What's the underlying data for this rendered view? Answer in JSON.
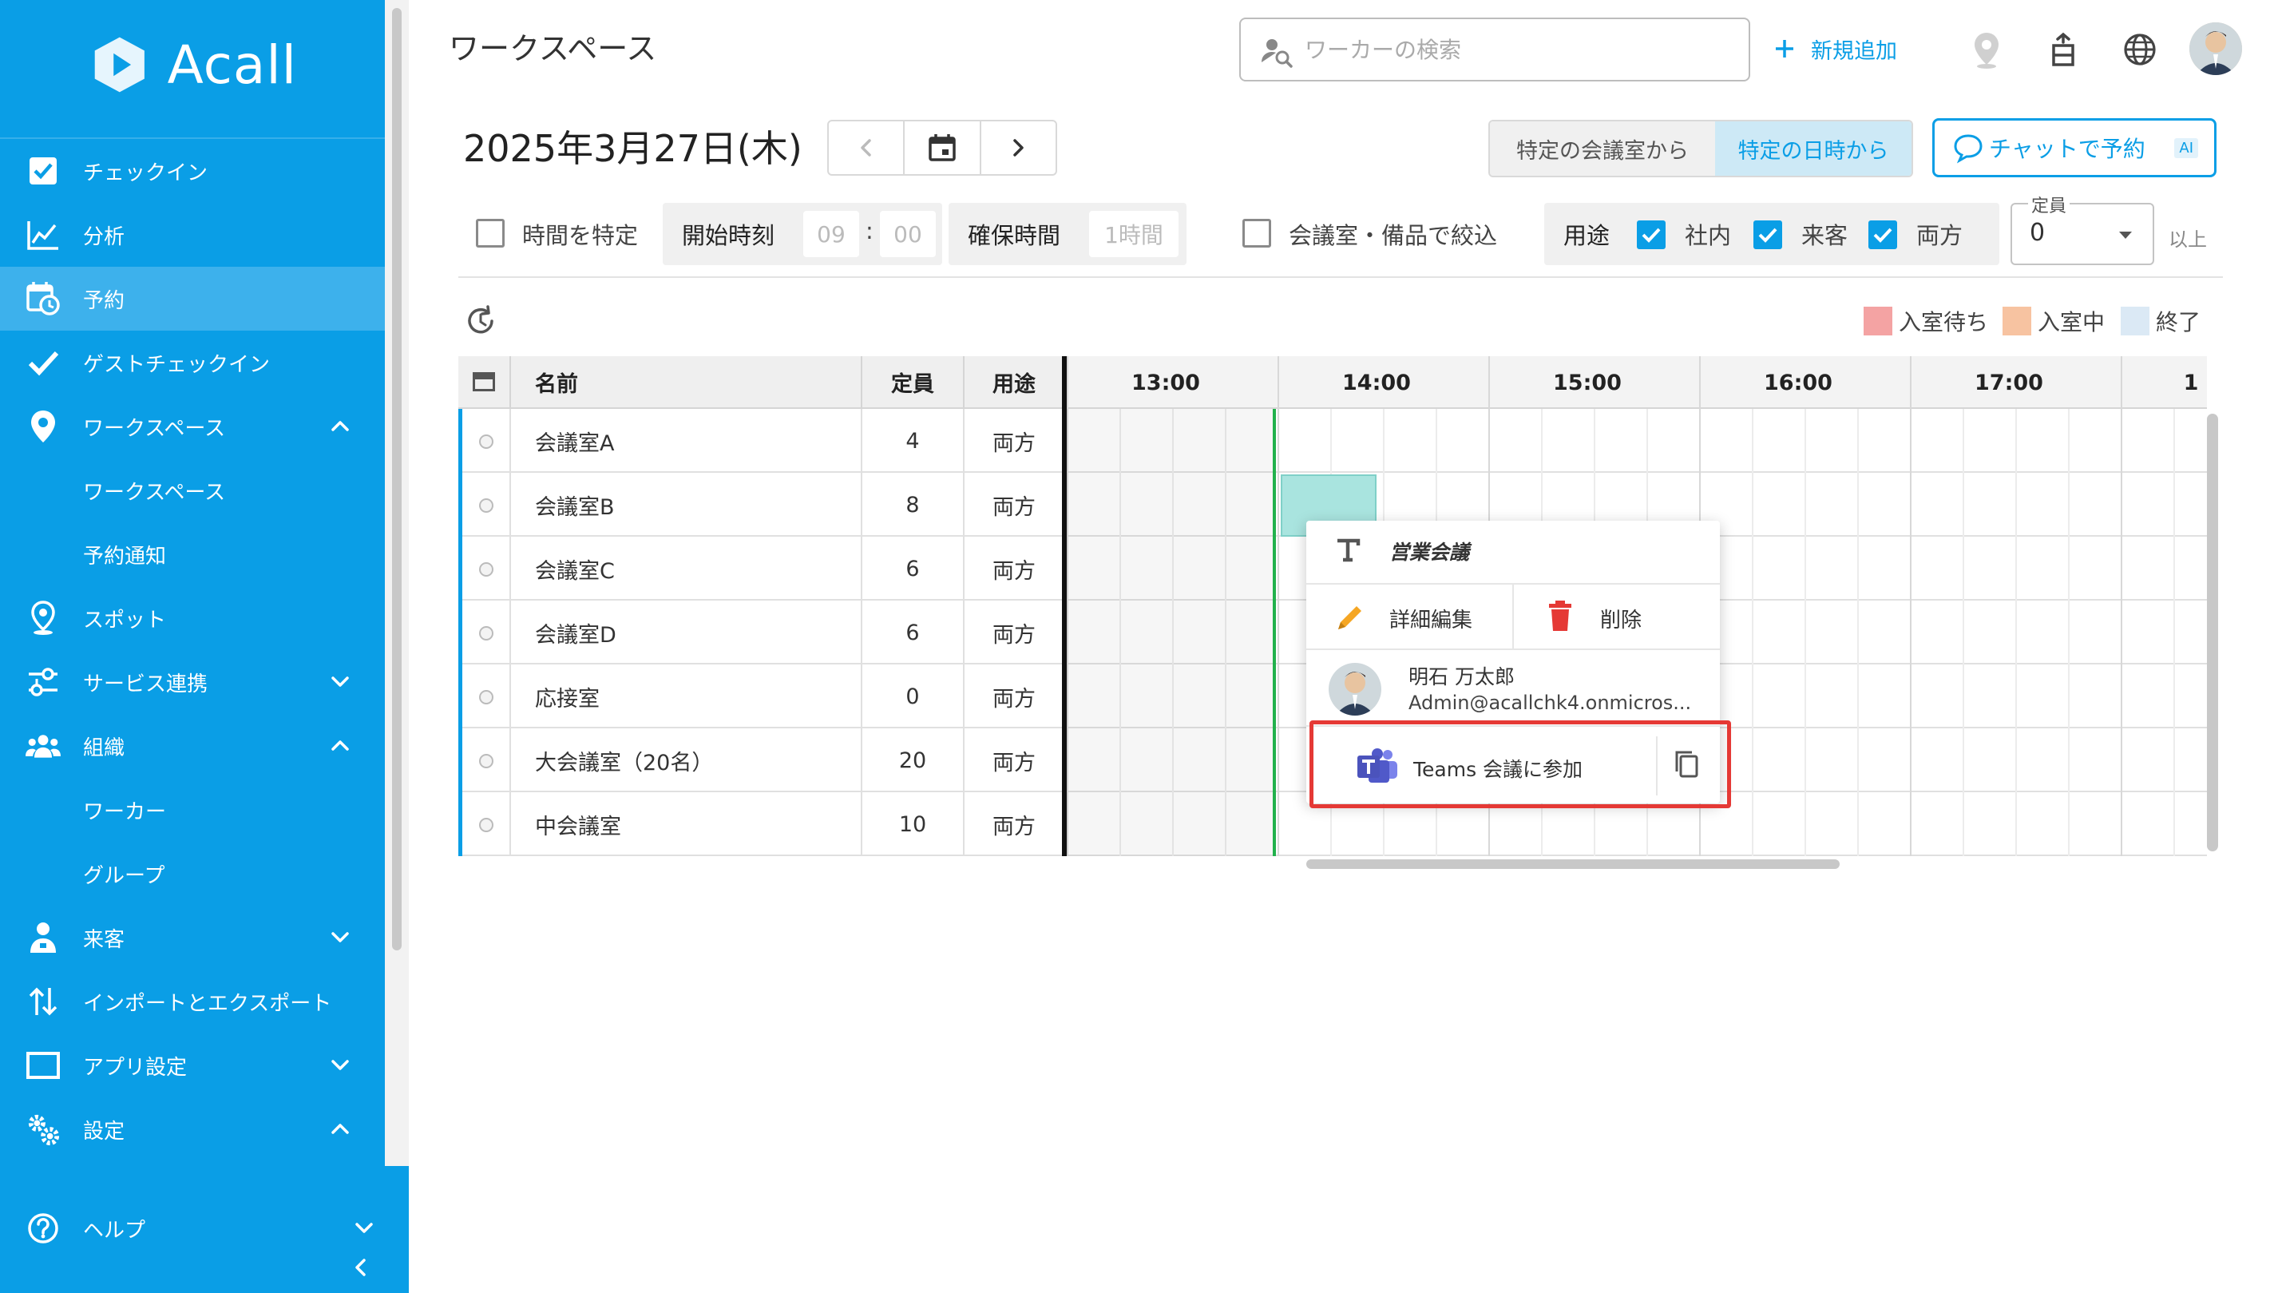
{
  "app": {
    "logo_text": "Acall"
  },
  "sidebar": {
    "items": [
      {
        "label": "チェックイン",
        "icon": "checkbox-icon"
      },
      {
        "label": "分析",
        "icon": "chart-icon"
      },
      {
        "label": "予約",
        "icon": "calendar-clock-icon",
        "active": true
      },
      {
        "label": "ゲストチェックイン",
        "icon": "checkmark-icon"
      },
      {
        "label": "ワークスペース",
        "icon": "location-pin-icon",
        "caret": "up"
      },
      {
        "label": "ワークスペース",
        "sub": true
      },
      {
        "label": "予約通知",
        "sub": true
      },
      {
        "label": "スポット",
        "icon": "spot-pin-icon"
      },
      {
        "label": "サービス連携",
        "icon": "integration-icon",
        "caret": "down"
      },
      {
        "label": "組織",
        "icon": "people-icon",
        "caret": "up"
      },
      {
        "label": "ワーカー",
        "sub": true
      },
      {
        "label": "グループ",
        "sub": true
      },
      {
        "label": "来客",
        "icon": "visitor-icon",
        "caret": "down"
      },
      {
        "label": "インポートとエクスポート",
        "icon": "import-export-icon"
      },
      {
        "label": "アプリ設定",
        "icon": "app-window-icon",
        "caret": "down"
      },
      {
        "label": "設定",
        "icon": "gear-icon",
        "caret": "up"
      }
    ],
    "help_label": "ヘルプ",
    "collapse_icon": "chevron-left-icon"
  },
  "header": {
    "title": "ワークスペース",
    "search_placeholder": "ワーカーの検索",
    "add_new_label": "新規追加"
  },
  "date_bar": {
    "date": "2025年3月27日(木)",
    "mode_room": "特定の会議室から",
    "mode_datetime": "特定の日時から",
    "chat_reserve": "チャットで予約",
    "ai_badge": "AI"
  },
  "filters": {
    "specify_time": "時間を特定",
    "start_time_label": "開始時刻",
    "start_hour": "09",
    "start_sep": ":",
    "start_min": "00",
    "duration_label": "確保時間",
    "duration_value": "1時間",
    "room_filter": "会議室・備品で絞込",
    "usage_label": "用途",
    "usage_internal": "社内",
    "usage_visitor": "来客",
    "usage_both": "両方",
    "capacity_legend": "定員",
    "capacity_value": "0",
    "capacity_suffix": "以上"
  },
  "legend": {
    "waiting": "入室待ち",
    "in_room": "入室中",
    "ended": "終了",
    "colors": {
      "waiting": "#f4a3a3",
      "in_room": "#f7c3a1",
      "ended": "#dbe9f5"
    }
  },
  "table": {
    "headers": {
      "name": "名前",
      "capacity": "定員",
      "usage": "用途"
    },
    "hours": [
      "13:00",
      "14:00",
      "15:00",
      "16:00",
      "17:00",
      "1"
    ],
    "rows": [
      {
        "name": "会議室A",
        "capacity": "4",
        "usage": "両方"
      },
      {
        "name": "会議室B",
        "capacity": "8",
        "usage": "両方"
      },
      {
        "name": "会議室C",
        "capacity": "6",
        "usage": "両方"
      },
      {
        "name": "会議室D",
        "capacity": "6",
        "usage": "両方"
      },
      {
        "name": "応接室",
        "capacity": "0",
        "usage": "両方"
      },
      {
        "name": "大会議室（20名）",
        "capacity": "20",
        "usage": "両方"
      },
      {
        "name": "中会議室",
        "capacity": "10",
        "usage": "両方"
      }
    ]
  },
  "popup": {
    "title": "営業会議",
    "edit_label": "詳細編集",
    "delete_label": "削除",
    "organizer_name": "明石 万太郎",
    "organizer_email": "Admin@acallchk4.onmicros...",
    "teams_label": "Teams 会議に参加"
  }
}
